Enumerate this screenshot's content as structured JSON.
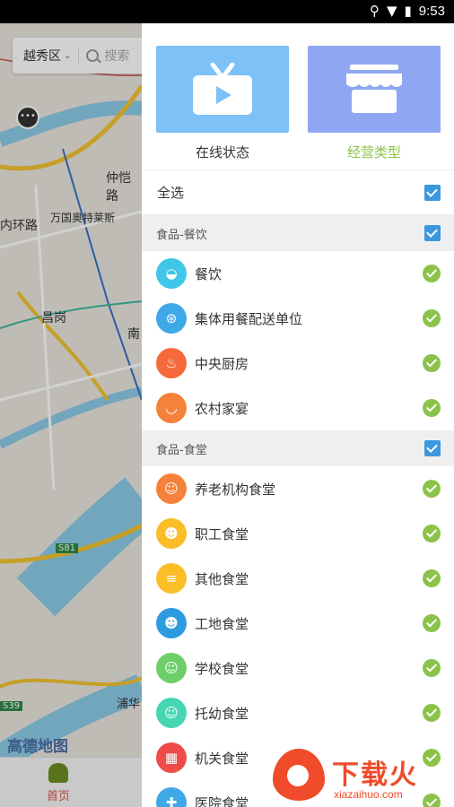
{
  "status_bar": {
    "time": "9:53"
  },
  "map": {
    "district": "越秀区",
    "search_placeholder": "搜索",
    "labels": [
      "仲恺路",
      "万国奥特莱斯",
      "内环路",
      "昌岗",
      "南",
      "浦华"
    ],
    "road_shields": [
      "S81",
      "S39"
    ],
    "logo": "高德地图",
    "pin_glyph": "•••"
  },
  "bottom_nav": {
    "home": "首页"
  },
  "drawer": {
    "modes": [
      {
        "label": "在线状态",
        "icon": "tv-icon",
        "color": "#7ec1f7"
      },
      {
        "label": "经营类型",
        "icon": "shop-icon",
        "color": "#8fa7f2",
        "active": true
      }
    ],
    "select_all": "全选",
    "sections": [
      {
        "title": "食品-餐饮",
        "items": [
          {
            "label": "餐饮",
            "icon": "cake-icon",
            "color": "#3fc6e8"
          },
          {
            "label": "集体用餐配送单位",
            "icon": "delivery-scooter-icon",
            "color": "#3fa9e8"
          },
          {
            "label": "中央厨房",
            "icon": "cooking-pot-icon",
            "color": "#f5693a"
          },
          {
            "label": "农村家宴",
            "icon": "bowl-icon",
            "color": "#f5823a"
          }
        ]
      },
      {
        "title": "食品-食堂",
        "items": [
          {
            "label": "养老机构食堂",
            "icon": "elderly-person-icon",
            "color": "#f5823a"
          },
          {
            "label": "职工食堂",
            "icon": "worker-icon",
            "color": "#fbbd28"
          },
          {
            "label": "其他食堂",
            "icon": "food-tray-icon",
            "color": "#fbbd28"
          },
          {
            "label": "工地食堂",
            "icon": "construction-worker-icon",
            "color": "#2d9be0"
          },
          {
            "label": "学校食堂",
            "icon": "student-icon",
            "color": "#6ccf6a"
          },
          {
            "label": "托幼食堂",
            "icon": "child-icon",
            "color": "#46d6b4"
          },
          {
            "label": "机关食堂",
            "icon": "government-building-icon",
            "color": "#f04b4b"
          },
          {
            "label": "医院食堂",
            "icon": "hospital-icon",
            "color": "#3fa9e8"
          }
        ]
      }
    ]
  },
  "watermark": {
    "title": "下载火",
    "subtitle": "xiazaihuo.com"
  }
}
